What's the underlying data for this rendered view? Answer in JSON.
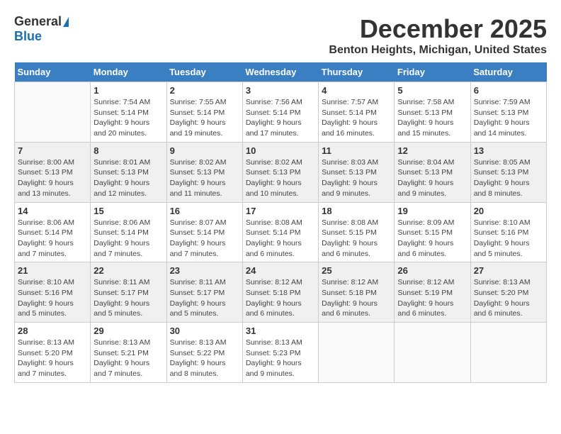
{
  "logo": {
    "general": "General",
    "blue": "Blue"
  },
  "title": "December 2025",
  "location": "Benton Heights, Michigan, United States",
  "days_of_week": [
    "Sunday",
    "Monday",
    "Tuesday",
    "Wednesday",
    "Thursday",
    "Friday",
    "Saturday"
  ],
  "weeks": [
    [
      {
        "day": "",
        "info": ""
      },
      {
        "day": "1",
        "info": "Sunrise: 7:54 AM\nSunset: 5:14 PM\nDaylight: 9 hours\nand 20 minutes."
      },
      {
        "day": "2",
        "info": "Sunrise: 7:55 AM\nSunset: 5:14 PM\nDaylight: 9 hours\nand 19 minutes."
      },
      {
        "day": "3",
        "info": "Sunrise: 7:56 AM\nSunset: 5:14 PM\nDaylight: 9 hours\nand 17 minutes."
      },
      {
        "day": "4",
        "info": "Sunrise: 7:57 AM\nSunset: 5:14 PM\nDaylight: 9 hours\nand 16 minutes."
      },
      {
        "day": "5",
        "info": "Sunrise: 7:58 AM\nSunset: 5:13 PM\nDaylight: 9 hours\nand 15 minutes."
      },
      {
        "day": "6",
        "info": "Sunrise: 7:59 AM\nSunset: 5:13 PM\nDaylight: 9 hours\nand 14 minutes."
      }
    ],
    [
      {
        "day": "7",
        "info": "Sunrise: 8:00 AM\nSunset: 5:13 PM\nDaylight: 9 hours\nand 13 minutes."
      },
      {
        "day": "8",
        "info": "Sunrise: 8:01 AM\nSunset: 5:13 PM\nDaylight: 9 hours\nand 12 minutes."
      },
      {
        "day": "9",
        "info": "Sunrise: 8:02 AM\nSunset: 5:13 PM\nDaylight: 9 hours\nand 11 minutes."
      },
      {
        "day": "10",
        "info": "Sunrise: 8:02 AM\nSunset: 5:13 PM\nDaylight: 9 hours\nand 10 minutes."
      },
      {
        "day": "11",
        "info": "Sunrise: 8:03 AM\nSunset: 5:13 PM\nDaylight: 9 hours\nand 9 minutes."
      },
      {
        "day": "12",
        "info": "Sunrise: 8:04 AM\nSunset: 5:13 PM\nDaylight: 9 hours\nand 9 minutes."
      },
      {
        "day": "13",
        "info": "Sunrise: 8:05 AM\nSunset: 5:13 PM\nDaylight: 9 hours\nand 8 minutes."
      }
    ],
    [
      {
        "day": "14",
        "info": "Sunrise: 8:06 AM\nSunset: 5:14 PM\nDaylight: 9 hours\nand 7 minutes."
      },
      {
        "day": "15",
        "info": "Sunrise: 8:06 AM\nSunset: 5:14 PM\nDaylight: 9 hours\nand 7 minutes."
      },
      {
        "day": "16",
        "info": "Sunrise: 8:07 AM\nSunset: 5:14 PM\nDaylight: 9 hours\nand 7 minutes."
      },
      {
        "day": "17",
        "info": "Sunrise: 8:08 AM\nSunset: 5:14 PM\nDaylight: 9 hours\nand 6 minutes."
      },
      {
        "day": "18",
        "info": "Sunrise: 8:08 AM\nSunset: 5:15 PM\nDaylight: 9 hours\nand 6 minutes."
      },
      {
        "day": "19",
        "info": "Sunrise: 8:09 AM\nSunset: 5:15 PM\nDaylight: 9 hours\nand 6 minutes."
      },
      {
        "day": "20",
        "info": "Sunrise: 8:10 AM\nSunset: 5:16 PM\nDaylight: 9 hours\nand 5 minutes."
      }
    ],
    [
      {
        "day": "21",
        "info": "Sunrise: 8:10 AM\nSunset: 5:16 PM\nDaylight: 9 hours\nand 5 minutes."
      },
      {
        "day": "22",
        "info": "Sunrise: 8:11 AM\nSunset: 5:17 PM\nDaylight: 9 hours\nand 5 minutes."
      },
      {
        "day": "23",
        "info": "Sunrise: 8:11 AM\nSunset: 5:17 PM\nDaylight: 9 hours\nand 5 minutes."
      },
      {
        "day": "24",
        "info": "Sunrise: 8:12 AM\nSunset: 5:18 PM\nDaylight: 9 hours\nand 6 minutes."
      },
      {
        "day": "25",
        "info": "Sunrise: 8:12 AM\nSunset: 5:18 PM\nDaylight: 9 hours\nand 6 minutes."
      },
      {
        "day": "26",
        "info": "Sunrise: 8:12 AM\nSunset: 5:19 PM\nDaylight: 9 hours\nand 6 minutes."
      },
      {
        "day": "27",
        "info": "Sunrise: 8:13 AM\nSunset: 5:20 PM\nDaylight: 9 hours\nand 6 minutes."
      }
    ],
    [
      {
        "day": "28",
        "info": "Sunrise: 8:13 AM\nSunset: 5:20 PM\nDaylight: 9 hours\nand 7 minutes."
      },
      {
        "day": "29",
        "info": "Sunrise: 8:13 AM\nSunset: 5:21 PM\nDaylight: 9 hours\nand 7 minutes."
      },
      {
        "day": "30",
        "info": "Sunrise: 8:13 AM\nSunset: 5:22 PM\nDaylight: 9 hours\nand 8 minutes."
      },
      {
        "day": "31",
        "info": "Sunrise: 8:13 AM\nSunset: 5:23 PM\nDaylight: 9 hours\nand 9 minutes."
      },
      {
        "day": "",
        "info": ""
      },
      {
        "day": "",
        "info": ""
      },
      {
        "day": "",
        "info": ""
      }
    ]
  ]
}
